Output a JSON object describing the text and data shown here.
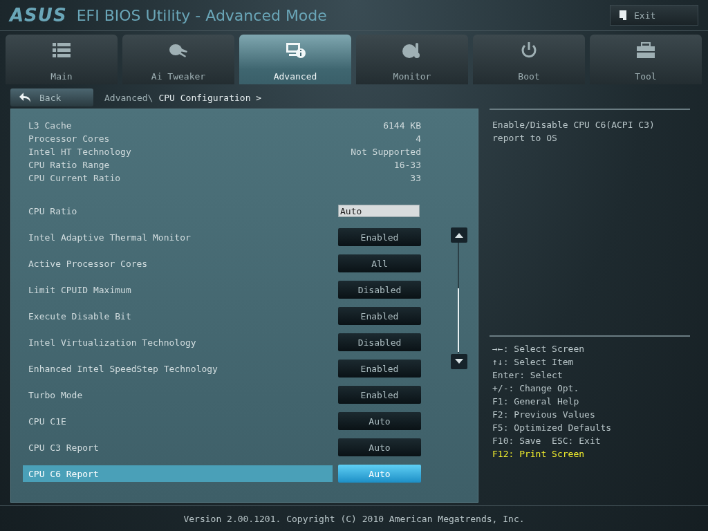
{
  "header": {
    "logo": "ASUS",
    "title": "EFI BIOS Utility - Advanced Mode",
    "exit_button": "Exit"
  },
  "tabs": [
    {
      "label": "Main",
      "selected": false
    },
    {
      "label": "Ai Tweaker",
      "selected": false
    },
    {
      "label": "Advanced",
      "selected": true
    },
    {
      "label": "Monitor",
      "selected": false
    },
    {
      "label": "Boot",
      "selected": false
    },
    {
      "label": "Tool",
      "selected": false
    }
  ],
  "back_button": "Back",
  "breadcrumb": {
    "path": "Advanced\\",
    "current": "CPU Configuration >"
  },
  "info_rows": [
    {
      "label": "L3 Cache",
      "value": "6144 KB"
    },
    {
      "label": "Processor Cores",
      "value": "4"
    },
    {
      "label": "Intel HT Technology",
      "value": "Not Supported"
    },
    {
      "label": "CPU Ratio Range",
      "value": "16-33"
    },
    {
      "label": "CPU Current Ratio",
      "value": "33"
    }
  ],
  "settings": [
    {
      "label": "CPU Ratio",
      "value": "Auto",
      "kind": "field",
      "selected": false
    },
    {
      "label": "Intel Adaptive Thermal Monitor",
      "value": "Enabled",
      "kind": "option",
      "selected": false
    },
    {
      "label": "Active Processor Cores",
      "value": "All",
      "kind": "option",
      "selected": false
    },
    {
      "label": "Limit CPUID Maximum",
      "value": "Disabled",
      "kind": "option",
      "selected": false
    },
    {
      "label": "Execute Disable Bit",
      "value": "Enabled",
      "kind": "option",
      "selected": false
    },
    {
      "label": "Intel Virtualization Technology",
      "value": "Disabled",
      "kind": "option",
      "selected": false
    },
    {
      "label": "Enhanced Intel SpeedStep Technology",
      "value": "Enabled",
      "kind": "option",
      "selected": false
    },
    {
      "label": "Turbo Mode",
      "value": "Enabled",
      "kind": "option",
      "selected": false
    },
    {
      "label": "CPU C1E",
      "value": "Auto",
      "kind": "option",
      "selected": false
    },
    {
      "label": "CPU C3 Report",
      "value": "Auto",
      "kind": "option",
      "selected": false
    },
    {
      "label": "CPU C6 Report",
      "value": "Auto",
      "kind": "option",
      "selected": true
    }
  ],
  "help_text": "Enable/Disable CPU C6(ACPI C3) report to OS",
  "key_help": [
    {
      "text": "→←: Select Screen",
      "highlighted": false
    },
    {
      "text": "↑↓: Select Item",
      "highlighted": false
    },
    {
      "text": "Enter: Select",
      "highlighted": false
    },
    {
      "text": "+/-: Change Opt.",
      "highlighted": false
    },
    {
      "text": "F1: General Help",
      "highlighted": false
    },
    {
      "text": "F2: Previous Values",
      "highlighted": false
    },
    {
      "text": "F5: Optimized Defaults",
      "highlighted": false
    },
    {
      "text": "F10: Save  ESC: Exit",
      "highlighted": false
    },
    {
      "text": "F12: Print Screen",
      "highlighted": true
    }
  ],
  "footer": "Version 2.00.1201. Copyright (C) 2010 American Megatrends, Inc."
}
